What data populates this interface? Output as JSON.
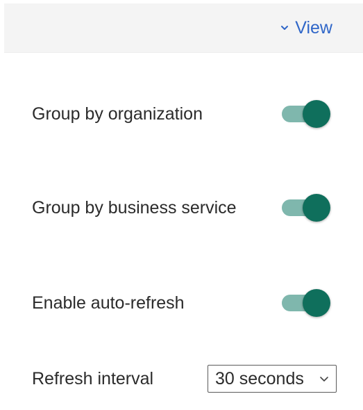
{
  "header": {
    "view_label": "View",
    "view_icon": "chevron-down-icon"
  },
  "settings": {
    "group_by_org": {
      "label": "Group by organization",
      "enabled": true
    },
    "group_by_service": {
      "label": "Group by business service",
      "enabled": true
    },
    "auto_refresh": {
      "label": "Enable auto-refresh",
      "enabled": true
    },
    "refresh_interval": {
      "label": "Refresh interval",
      "value": "30 seconds"
    }
  },
  "colors": {
    "accent_link": "#2f66c8",
    "toggle_track": "#7fb7ad",
    "toggle_thumb": "#0f6f5c",
    "header_bg": "#f4f4f4"
  }
}
